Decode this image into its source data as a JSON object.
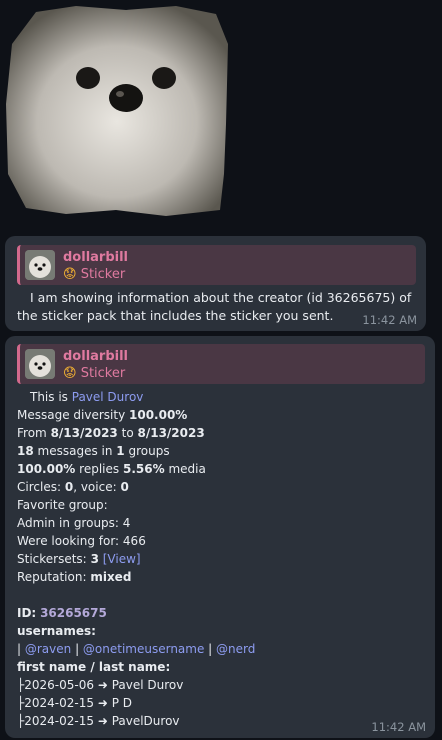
{
  "sticker": {
    "alt": "white dog sticker",
    "icon": "dog-sticker-image"
  },
  "messages": [
    {
      "reply": {
        "name": "dollarbill",
        "emoji": "😟",
        "label": "Sticker"
      },
      "text": "I am showing information about the creator (id 36265675) of the sticker pack that includes the sticker you sent.",
      "time": "11:42 AM"
    },
    {
      "reply": {
        "name": "dollarbill",
        "emoji": "😟",
        "label": "Sticker"
      },
      "time": "11:42 AM",
      "info": {
        "this_is": "This is",
        "user_name": "Pavel Durov",
        "diversity_label": "Message diversity",
        "diversity_value": "100.00%",
        "from_label": "From",
        "from_date": "8/13/2023",
        "to_label": "to",
        "to_date": "8/13/2023",
        "messages_count": "18",
        "messages_in": "messages in",
        "groups_count": "1",
        "groups_label": "groups",
        "replies_pct": "100.00%",
        "replies_label": "replies",
        "media_pct": "5.56%",
        "media_label": "media",
        "circles_label": "Circles:",
        "circles_value": "0",
        "voice_label": "voice:",
        "voice_value": "0",
        "favorite_group": "Favorite group:",
        "admin_label": "Admin in groups:",
        "admin_value": "4",
        "looking_label": "Were looking for:",
        "looking_value": "466",
        "stickersets_label": "Stickersets:",
        "stickersets_value": "3",
        "view_link": "[View]",
        "reputation_label": "Reputation:",
        "reputation_value": "mixed",
        "id_label": "ID:",
        "id_value": "36265675",
        "usernames_label": "usernames:",
        "usernames": [
          "@raven",
          "@onetimeusername",
          "@nerd"
        ],
        "names_label": "first name / last name:",
        "name_history": [
          {
            "date": "2026-05-06",
            "name": "Pavel Durov"
          },
          {
            "date": "2024-02-15",
            "name": "P D"
          },
          {
            "date": "2024-02-15",
            "name": "PavelDurov"
          }
        ]
      }
    }
  ]
}
